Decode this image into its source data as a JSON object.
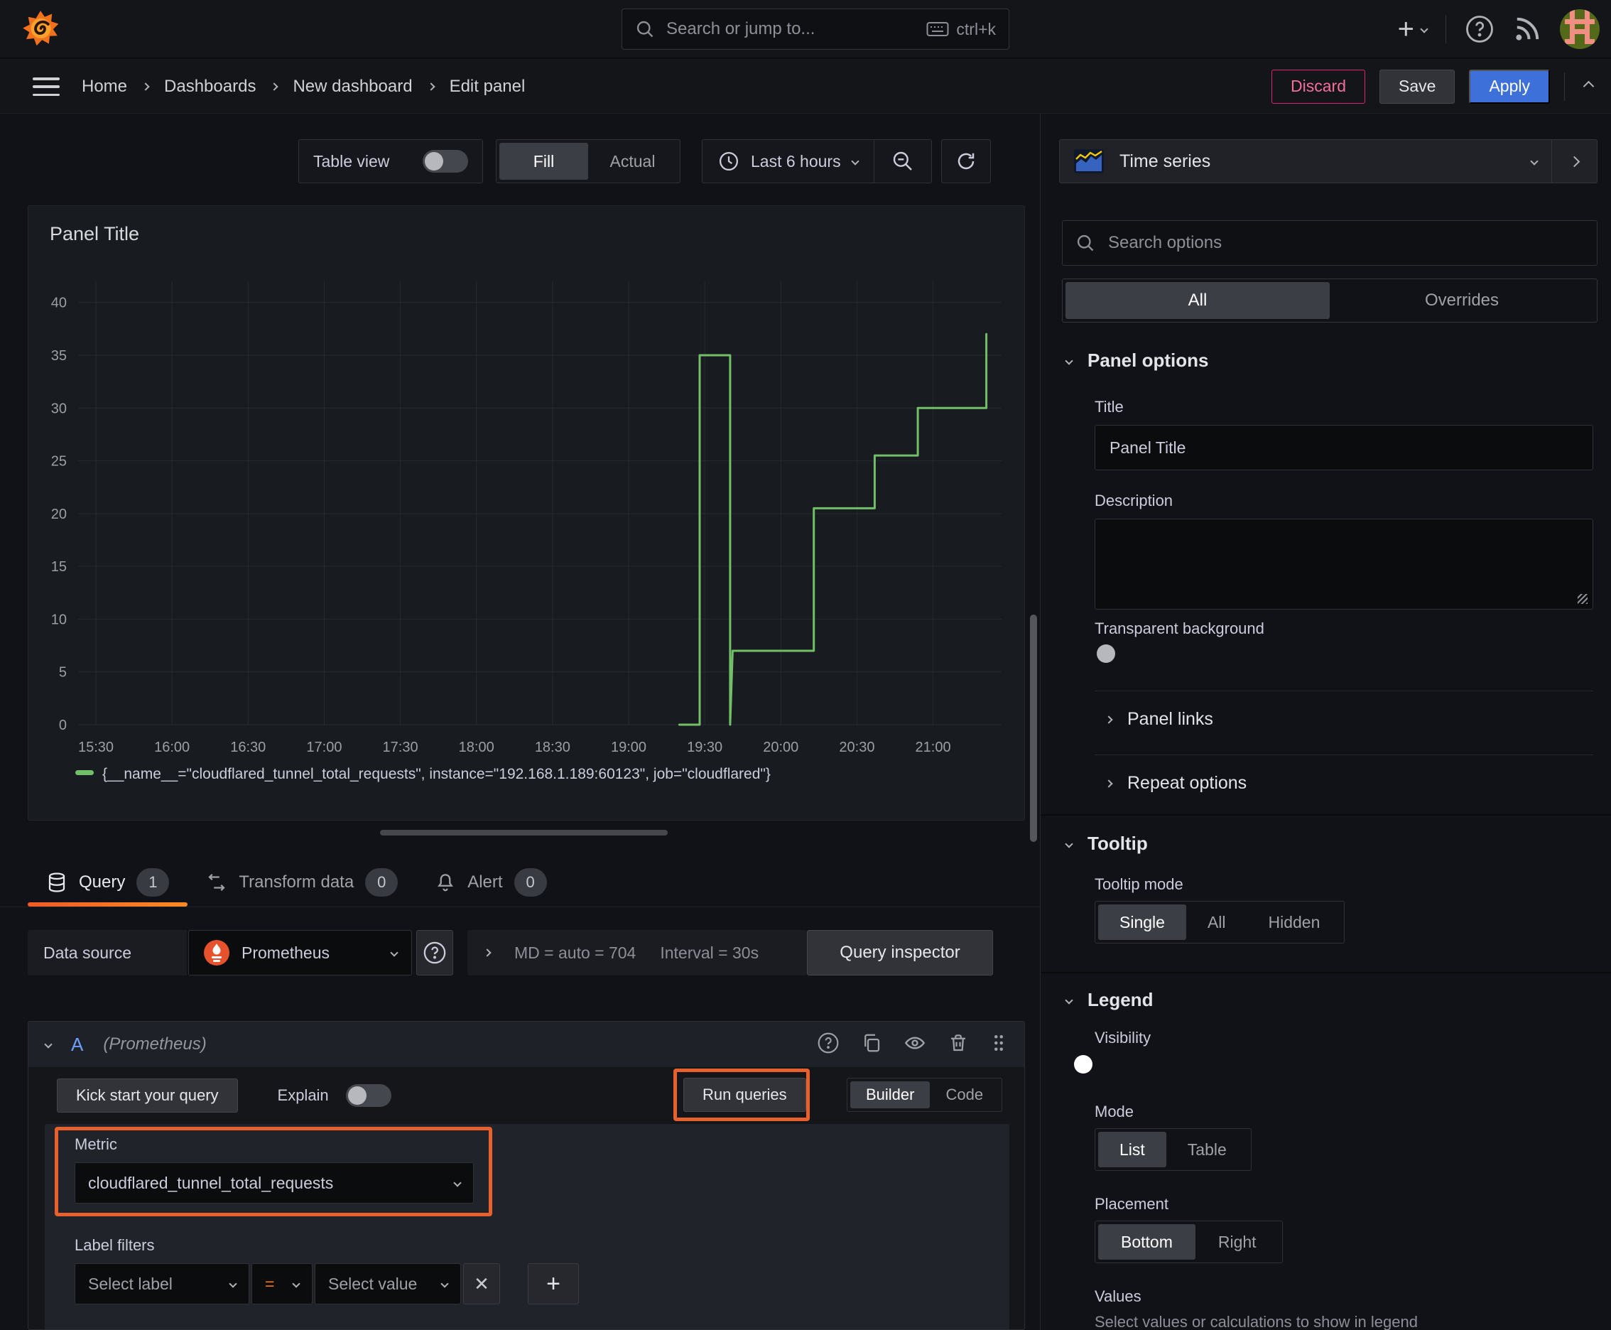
{
  "topbar": {
    "search_placeholder": "Search or jump to...",
    "search_shortcut": "ctrl+k"
  },
  "breadcrumb": {
    "items": [
      "Home",
      "Dashboards",
      "New dashboard",
      "Edit panel"
    ]
  },
  "header_actions": {
    "discard": "Discard",
    "save": "Save",
    "apply": "Apply"
  },
  "panel_toolbar": {
    "table_view": "Table view",
    "fill": "Fill",
    "actual": "Actual",
    "time_range": "Last 6 hours"
  },
  "viz_picker": {
    "label": "Time series"
  },
  "chart_data": {
    "type": "line",
    "title": "Panel Title",
    "x_tick_labels": [
      "15:30",
      "16:00",
      "16:30",
      "17:00",
      "17:30",
      "18:00",
      "18:30",
      "19:00",
      "19:30",
      "20:00",
      "20:30",
      "21:00"
    ],
    "y_ticks": [
      0,
      5,
      10,
      15,
      20,
      25,
      30,
      35,
      40
    ],
    "ylim": [
      0,
      42
    ],
    "x_range_minutes": [
      923,
      1287
    ],
    "grid": true,
    "legend_position": "bottom",
    "series": [
      {
        "name": "{__name__=\"cloudflared_tunnel_total_requests\", instance=\"192.168.1.189:60123\", job=\"cloudflared\"}",
        "color": "#73bf69",
        "step": true,
        "points": [
          [
            "19:20",
            0
          ],
          [
            "19:28",
            0
          ],
          [
            "19:28",
            35
          ],
          [
            "19:40",
            35
          ],
          [
            "19:40",
            0
          ],
          [
            "19:41",
            7
          ],
          [
            "20:13",
            7
          ],
          [
            "20:13",
            20.5
          ],
          [
            "20:37",
            20.5
          ],
          [
            "20:37",
            25.5
          ],
          [
            "20:54",
            25.5
          ],
          [
            "20:54",
            30
          ],
          [
            "21:21",
            30
          ],
          [
            "21:21",
            37
          ]
        ]
      }
    ]
  },
  "query_tabs": {
    "query": {
      "label": "Query",
      "count": "1"
    },
    "transform": {
      "label": "Transform data",
      "count": "0"
    },
    "alert": {
      "label": "Alert",
      "count": "0"
    }
  },
  "query_editor": {
    "datasource_label": "Data source",
    "datasource_name": "Prometheus",
    "stats": "MD = auto = 704",
    "interval": "Interval = 30s",
    "query_inspector": "Query inspector",
    "row": {
      "ref_id": "A",
      "datasource_hint": "(Prometheus)"
    },
    "kick_start": "Kick start your query",
    "explain": "Explain",
    "run_queries": "Run queries",
    "builder": "Builder",
    "code": "Code",
    "metric": {
      "label": "Metric",
      "value": "cloudflared_tunnel_total_requests"
    },
    "label_filters": {
      "label": "Label filters",
      "select_label": "Select label",
      "operator": "=",
      "select_value": "Select value"
    }
  },
  "sidebar": {
    "search_placeholder": "Search options",
    "tabs": {
      "all": "All",
      "overrides": "Overrides"
    },
    "panel_options": {
      "title": "Panel options",
      "title_label": "Title",
      "title_value": "Panel Title",
      "description_label": "Description",
      "transparent_bg": "Transparent background"
    },
    "collapsed": {
      "panel_links": "Panel links",
      "repeat_options": "Repeat options"
    },
    "tooltip": {
      "title": "Tooltip",
      "mode_label": "Tooltip mode",
      "modes": [
        "Single",
        "All",
        "Hidden"
      ],
      "active_mode": "Single"
    },
    "legend": {
      "title": "Legend",
      "visibility_label": "Visibility",
      "mode_label": "Mode",
      "modes": [
        "List",
        "Table"
      ],
      "active_mode": "List",
      "placement_label": "Placement",
      "placements": [
        "Bottom",
        "Right"
      ],
      "active_placement": "Bottom",
      "values_label": "Values",
      "values_hint": "Select values or calculations to show in legend"
    }
  },
  "colors": {
    "accent_orange": "#ff780a",
    "highlight_orange": "#e8612c",
    "blue": "#3d71d9",
    "green": "#73bf69",
    "discard_pink": "#e0226e"
  }
}
